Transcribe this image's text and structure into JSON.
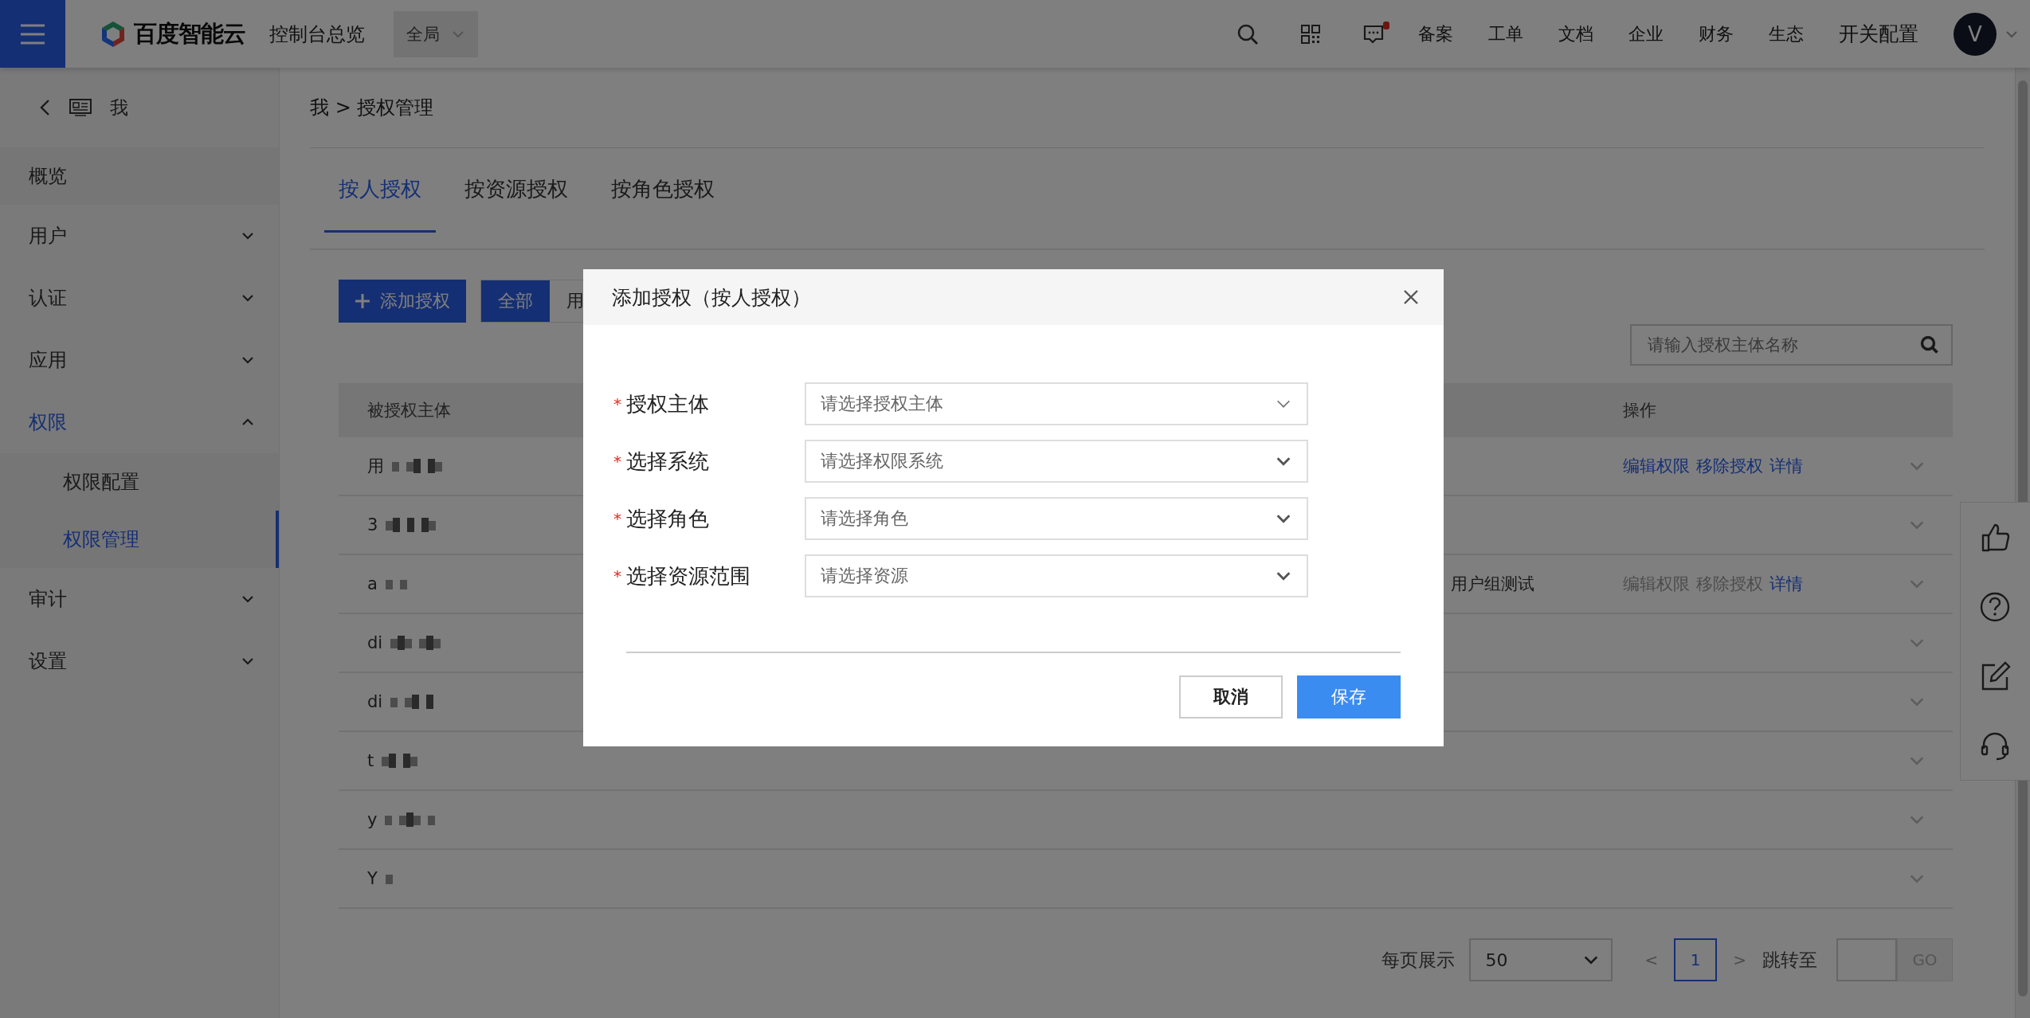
{
  "top_bar": {
    "brand": "百度智能云",
    "console": "控制台总览",
    "region": "全局",
    "notification_dot": true,
    "nav": [
      "备案",
      "工单",
      "文档",
      "企业",
      "财务",
      "生态"
    ],
    "config": "开关配置",
    "avatar": "V"
  },
  "sidebar": {
    "title": "我",
    "items": [
      {
        "label": "概览",
        "kind": "link",
        "selected": false
      },
      {
        "label": "用户",
        "kind": "group",
        "selected": false,
        "expanded": false
      },
      {
        "label": "认证",
        "kind": "group",
        "selected": false,
        "expanded": false
      },
      {
        "label": "应用",
        "kind": "group",
        "selected": false,
        "expanded": false
      },
      {
        "label": "权限",
        "kind": "group",
        "selected": true,
        "expanded": true,
        "children": [
          {
            "label": "权限配置",
            "selected": false
          },
          {
            "label": "权限管理",
            "selected": true
          }
        ]
      },
      {
        "label": "审计",
        "kind": "group",
        "selected": false,
        "expanded": false
      },
      {
        "label": "设置",
        "kind": "group",
        "selected": false,
        "expanded": false
      }
    ]
  },
  "breadcrumb": "我 > 授权管理",
  "tabs": [
    {
      "label": "按人授权",
      "selected": true
    },
    {
      "label": "按资源授权",
      "selected": false
    },
    {
      "label": "按角色授权",
      "selected": false
    }
  ],
  "toolbar": {
    "add_button": "添加授权",
    "filters": [
      {
        "label": "全部",
        "selected": true
      },
      {
        "label": "用",
        "selected": false
      }
    ]
  },
  "search": {
    "placeholder": "请输入授权主体名称"
  },
  "table": {
    "columns": [
      "被授权主体",
      "操作"
    ],
    "rows": [
      {
        "subject": "用",
        "actions": [
          {
            "label": "编辑权限",
            "disabled": false
          },
          {
            "label": "移除授权",
            "disabled": false
          },
          {
            "label": "详情",
            "disabled": false
          }
        ]
      },
      {
        "subject": "3"
      },
      {
        "subject": "a",
        "resource": "用户组测试",
        "actions": [
          {
            "label": "编辑权限",
            "disabled": true
          },
          {
            "label": "移除授权",
            "disabled": true
          },
          {
            "label": "详情",
            "disabled": false
          }
        ]
      },
      {
        "subject": "di"
      },
      {
        "subject": "di"
      },
      {
        "subject": "t"
      },
      {
        "subject": "y"
      },
      {
        "subject": "Y"
      }
    ]
  },
  "pagination": {
    "page_size_label": "每页展示",
    "page_size": "50",
    "prev": "<",
    "pages": [
      {
        "label": "1",
        "selected": true
      }
    ],
    "next": ">",
    "jump_label": "跳转至",
    "go": "GO"
  },
  "dialog": {
    "title": "添加授权（按人授权）",
    "fields": [
      {
        "required_mark": "*",
        "label": "授权主体",
        "placeholder": "请选择授权主体"
      },
      {
        "required_mark": "*",
        "label": "选择系统",
        "placeholder": "请选择权限系统"
      },
      {
        "required_mark": "*",
        "label": "选择角色",
        "placeholder": "请选择角色"
      },
      {
        "required_mark": "*",
        "label": "选择资源范围",
        "placeholder": "请选择资源"
      }
    ],
    "buttons": [
      {
        "label": "取消",
        "kind": "secondary"
      },
      {
        "label": "保存",
        "kind": "primary"
      }
    ]
  }
}
